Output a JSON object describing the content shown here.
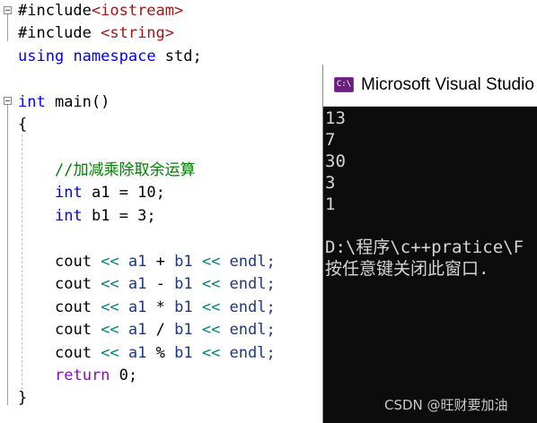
{
  "editor": {
    "line1": {
      "text": "#include",
      "arg": "<iostream>"
    },
    "line2": {
      "text": "#include ",
      "arg": "<string>"
    },
    "line3": {
      "kw1": "using",
      "kw2": "namespace",
      "rest": " std;"
    },
    "line4": {
      "type": "int",
      "name": " main()"
    },
    "line5": "{",
    "line6": "//加减乘除取余运算",
    "line7": {
      "type": "int",
      "rest": " a1 = 10;"
    },
    "line8": {
      "type": "int",
      "rest": " b1 = 3;"
    },
    "cout_lines": [
      {
        "cout": "cout",
        "op1": " << ",
        "a": "a1",
        "sym": " + ",
        "b": "b1",
        "op2": " << ",
        "endl": "endl;"
      },
      {
        "cout": "cout",
        "op1": " << ",
        "a": "a1",
        "sym": " - ",
        "b": "b1",
        "op2": " << ",
        "endl": "endl;"
      },
      {
        "cout": "cout",
        "op1": " << ",
        "a": "a1",
        "sym": " * ",
        "b": "b1",
        "op2": " << ",
        "endl": "endl;"
      },
      {
        "cout": "cout",
        "op1": " << ",
        "a": "a1",
        "sym": " / ",
        "b": "b1",
        "op2": " << ",
        "endl": "endl;"
      },
      {
        "cout": "cout",
        "op1": " << ",
        "a": "a1",
        "sym": " % ",
        "b": "b1",
        "op2": " << ",
        "endl": "endl;"
      }
    ],
    "line_return": {
      "kw": "return",
      "rest": " 0;"
    },
    "line_close": "}"
  },
  "console": {
    "title": "Microsoft Visual Studio",
    "icon_label": "C:\\",
    "output": [
      "13",
      "7",
      "30",
      "3",
      "1"
    ],
    "path_line": "D:\\程序\\c++pratice\\F",
    "prompt_line": "按任意键关闭此窗口."
  },
  "watermark": "CSDN @旺财要加油",
  "colors": {
    "keyword": "#0000ff",
    "string": "#a31515",
    "comment": "#008000",
    "return_kw": "#8f08c4",
    "console_bg": "#0c0c0c",
    "console_fg": "#d4d4d4"
  }
}
